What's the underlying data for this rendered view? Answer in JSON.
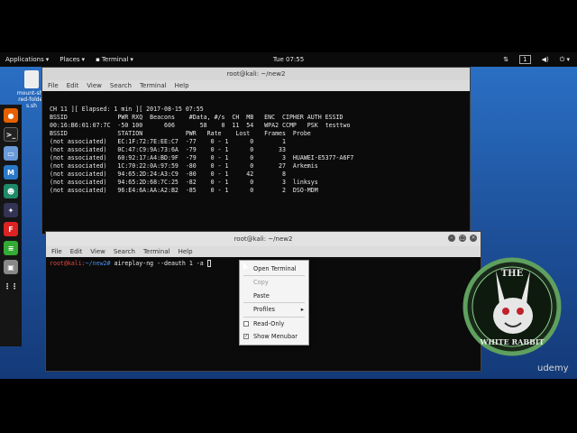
{
  "topbar": {
    "applications": "Applications",
    "places": "Places",
    "terminal": "Terminal",
    "clock": "Tue 07:55",
    "workspace": "1"
  },
  "desktop": {
    "file_icon_label": "mount-shared-folders.sh"
  },
  "back_window": {
    "title": "root@kali: ~/new2",
    "menu": [
      "File",
      "Edit",
      "View",
      "Search",
      "Terminal",
      "Help"
    ],
    "lines": [
      " CH 11 ][ Elapsed: 1 min ][ 2017-08-15 07:55",
      "",
      " BSSID              PWR RXQ  Beacons    #Data, #/s  CH  MB   ENC  CIPHER AUTH ESSID",
      "",
      " 00:16:B6:01:07:7C  -50 100      606       58    0  11  54   WPA2 CCMP   PSK  testtwo",
      "",
      " BSSID              STATION            PWR   Rate    Lost    Frames  Probe",
      "",
      " (not associated)   EC:1F:72:7E:EE:C7  -77    0 - 1      0        1",
      " (not associated)   0C:47:C9:9A:73:6A  -79    0 - 1      0       33",
      " (not associated)   60:92:17:A4:BD:9F  -79    0 - 1      0        3  HUAWEI-E5377-A6F7",
      " (not associated)   1C:70:22:0A:97:59  -80    0 - 1      0       27  Arkemis",
      " (not associated)   94:65:2D:24:A3:C9  -80    0 - 1     42        8",
      " (not associated)   94:65:2D:68:7C:25  -82    0 - 1      0        3  linksys",
      " (not associated)   96:E4:6A:AA:A2:B2  -85    0 - 1      0        2  DSO-MDM"
    ]
  },
  "front_window": {
    "title": "root@kali: ~/new2",
    "menu": [
      "File",
      "Edit",
      "View",
      "Search",
      "Terminal",
      "Help"
    ],
    "prompt_user": "root@kali",
    "prompt_path": ":~/new2#",
    "command": " aireplay-ng --deauth 1 -a "
  },
  "context_menu": {
    "items": [
      {
        "label": "Open Terminal",
        "enabled": true
      },
      {
        "label": "Copy",
        "enabled": false
      },
      {
        "label": "Paste",
        "enabled": true
      },
      {
        "label": "Profiles",
        "enabled": true,
        "submenu": true
      },
      {
        "label": "Read-Only",
        "enabled": true,
        "checkbox": true,
        "checked": false
      },
      {
        "label": "Show Menubar",
        "enabled": true,
        "checkbox": true,
        "checked": true
      }
    ]
  },
  "watermark": {
    "logo_top": "THE",
    "logo_mid": "WHITE RABBIT",
    "brand": "udemy"
  },
  "colors": {
    "prompt_user": "#e3473f",
    "prompt_path": "#4a8ee8"
  }
}
